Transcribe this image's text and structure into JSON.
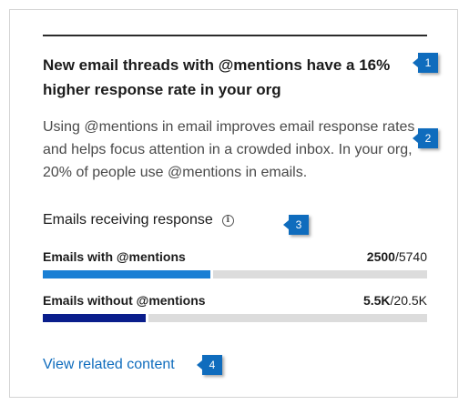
{
  "card": {
    "headline": "New email threads with @mentions have a 16% higher response rate in your org",
    "body": "Using @mentions in email improves email response rates and helps focus attention in a crowded inbox. In your org, 20% of people use @mentions in emails.",
    "section_title": "Emails receiving response",
    "info_icon": "info-icon",
    "metrics": [
      {
        "label": "Emails with @mentions",
        "value": "2500",
        "total": "/5740",
        "fraction": 0.4355,
        "color": "#1a7fd4"
      },
      {
        "label": "Emails without @mentions",
        "value": "5.5K",
        "total": "/20.5K",
        "fraction": 0.2683,
        "color": "#0a1e8c"
      }
    ],
    "link_label": "View related content"
  },
  "markers": [
    "1",
    "2",
    "3",
    "4"
  ],
  "colors": {
    "accent": "#0f6cbd",
    "track": "#dcdcdc"
  }
}
